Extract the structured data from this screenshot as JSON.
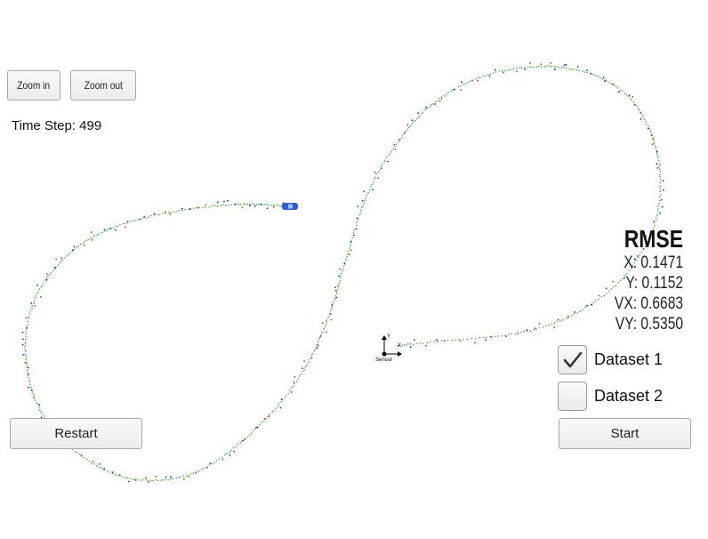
{
  "toolbar": {
    "zoom_in_label": "Zoom in",
    "zoom_out_label": "Zoom out"
  },
  "status": {
    "time_step_label": "Time Step: 499"
  },
  "rmse": {
    "title": "RMSE",
    "x": "X: 0.1471",
    "y": "Y: 0.1152",
    "vx": "VX: 0.6683",
    "vy": "VY: 0.5350"
  },
  "datasets": [
    {
      "label": "Dataset 1",
      "checked": true
    },
    {
      "label": "Dataset 2",
      "checked": false
    }
  ],
  "controls": {
    "restart_label": "Restart",
    "start_label": "Start"
  },
  "sensor": {
    "label": "Sensor",
    "axis_x": "X",
    "axis_y": "Y"
  },
  "colors": {
    "ground_truth": "#2db82d",
    "lidar": "#e02020",
    "radar": "#2020e0",
    "estimate": "#22aa55",
    "car": "#2a5fd8"
  },
  "icons": {
    "checkmark": "checkmark-icon",
    "car": "car-icon",
    "sensor_axes": "sensor-axes-icon"
  }
}
